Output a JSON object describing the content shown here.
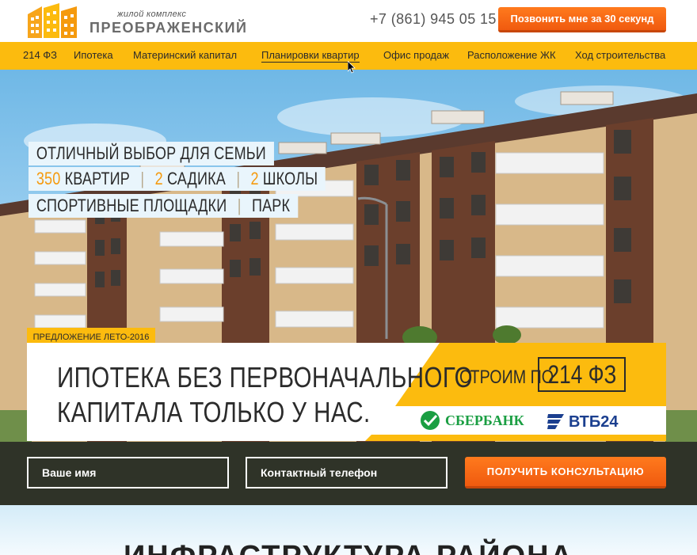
{
  "header": {
    "logo_small": "жилой комплекс",
    "logo_big": "ПРЕОБРАЖЕНСКИЙ",
    "phone": "+7 (861) 945 05 15",
    "callback_label": "Позвонить мне за 30 секунд"
  },
  "nav": {
    "items": [
      {
        "label": "214 ФЗ"
      },
      {
        "label": "Ипотека"
      },
      {
        "label": "Материнский капитал"
      },
      {
        "label": "Планировки квартир"
      },
      {
        "label": "Офис продаж"
      },
      {
        "label": "Расположение ЖК"
      },
      {
        "label": "Ход строительства"
      }
    ],
    "active": "Планировки квартир"
  },
  "hero": {
    "tagline": "ОТЛИЧНЫЙ ВЫБОР ДЛЯ СЕМЬИ",
    "stat1_num": "350",
    "stat1_label": "КВАРТИР",
    "stat2_num": "2",
    "stat2_label": "САДИКА",
    "stat3_num": "2",
    "stat3_label": "ШКОЛЫ",
    "feature1": "СПОРТИВНЫЕ ПЛОЩАДКИ",
    "feature2": "ПАРК"
  },
  "offer": {
    "badge": "ПРЕДЛОЖЕНИЕ ЛЕТО-2016",
    "title_line1": "ИПОТЕКА БЕЗ ПЕРВОНАЧАЛЬНОГО",
    "title_line2": "КАПИТАЛА ТОЛЬКО У НАС.",
    "build_label": "СТРОИМ ПО",
    "build_law": "214 ФЗ",
    "bank1": "СБЕРБАНК",
    "bank2": "ВТБ24"
  },
  "form": {
    "name_placeholder": "Ваше имя",
    "phone_placeholder": "Контактный телефон",
    "submit_label": "ПОЛУЧИТЬ КОНСУЛЬТАЦИЮ"
  },
  "next_section": {
    "title": "ИНФРАСТРУКТУРА РАЙОНА"
  },
  "colors": {
    "accent_yellow": "#fcbb0e",
    "accent_orange": "#f26a14",
    "dark_band": "#2f3328"
  }
}
